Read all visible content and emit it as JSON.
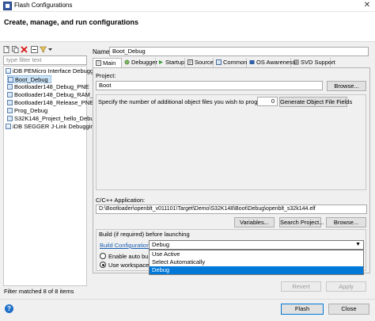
{
  "window": {
    "title": "Flash Configurations",
    "close_glyph": "✕"
  },
  "header": {
    "title": "Create, manage, and run configurations"
  },
  "sidebar": {
    "filter_placeholder": "type filter text",
    "items": [
      {
        "label": "iDB PEMicro Interface Debugging",
        "kind": "group"
      },
      {
        "label": "Boot_Debug",
        "kind": "config",
        "selected": true
      },
      {
        "label": "Bootloader148_Debug_PNE",
        "kind": "config"
      },
      {
        "label": "Bootloader148_Debug_RAM_PNE",
        "kind": "config"
      },
      {
        "label": "Bootloader148_Release_PNE",
        "kind": "config"
      },
      {
        "label": "Prog_Debug",
        "kind": "config"
      },
      {
        "label": "S32K148_Project_hello_Debug",
        "kind": "config"
      },
      {
        "label": "iDB SEGGER J-Link Debugging",
        "kind": "group"
      }
    ],
    "status": "Filter matched 8 of 8 items"
  },
  "config": {
    "name_label": "Name:",
    "name_value": "Boot_Debug",
    "tabs": [
      {
        "label": "Main",
        "icon": "main-icon",
        "active": true
      },
      {
        "label": "Debugger",
        "icon": "debugger-icon"
      },
      {
        "label": "Startup",
        "icon": "startup-icon"
      },
      {
        "label": "Source",
        "icon": "source-icon"
      },
      {
        "label": "Common",
        "icon": "common-icon"
      },
      {
        "label": "OS Awareness",
        "icon": "os-awareness-icon"
      },
      {
        "label": "SVD Support",
        "icon": "svd-support-icon"
      }
    ],
    "main": {
      "project_label": "Project:",
      "project_value": "Boot",
      "browse_label": "Browse...",
      "object_files_label": "Specify the number of additional object files you wish to program:",
      "object_files_value": "0",
      "generate_label": "Generate Object File Fields",
      "app_label": "C/C++ Application:",
      "app_value": "D:\\Bootloader\\openblt_v011101\\Target\\Demo\\S32K148\\Boot\\Debug\\openblt_s32k144.elf",
      "variables_label": "Variables...",
      "search_project_label": "Search Project...",
      "browse2_label": "Browse...",
      "build_label": "Build (if required) before launching",
      "build_config_label": "Build Configuration:",
      "build_config_value": "Debug",
      "build_config_options": [
        "Use Active",
        "Select Automatically",
        "Debug"
      ],
      "highlighted_option": "Debug",
      "enable_auto_label": "Enable auto build",
      "use_workspace_label": "Use workspace se"
    },
    "revert_label": "Revert",
    "apply_label": "Apply"
  },
  "footer": {
    "help_glyph": "?",
    "flash_label": "Flash",
    "close_label": "Close"
  },
  "colors": {
    "accent": "#0078d7",
    "link": "#1a5fb4",
    "selection": "#cce4f7"
  }
}
